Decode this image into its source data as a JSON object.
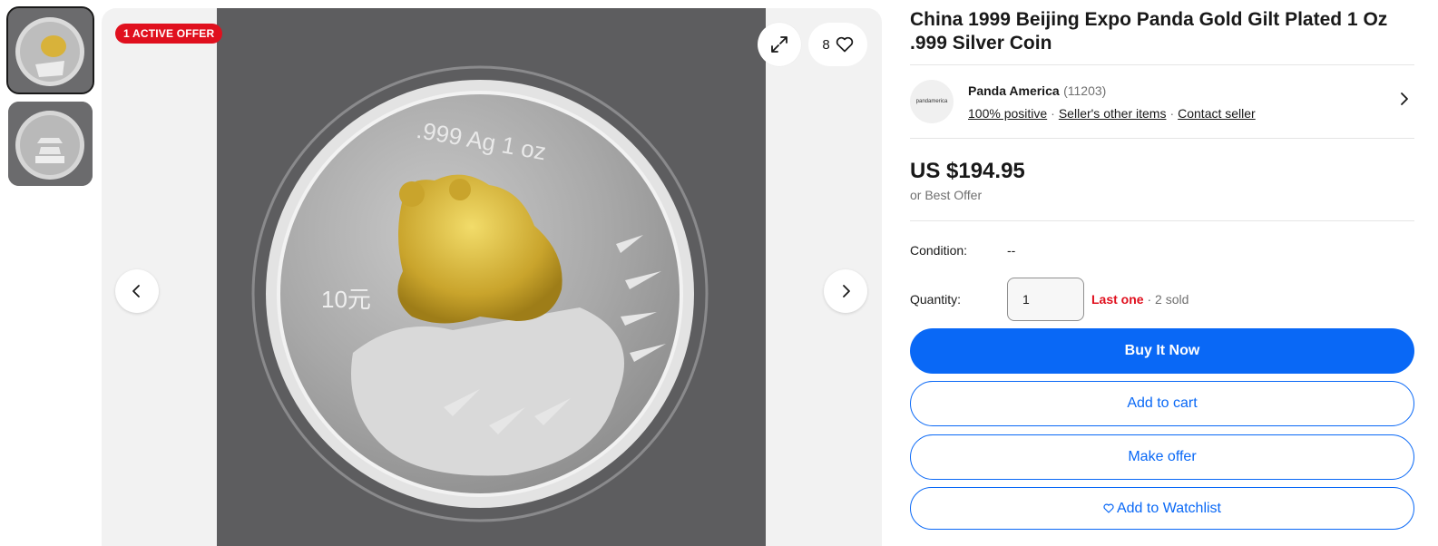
{
  "badge": {
    "active_offer": "1 ACTIVE OFFER"
  },
  "gallery": {
    "watch_count": "8",
    "icons": {
      "expand": "expand-icon",
      "heart": "heart-icon",
      "prev": "chevron-left-icon",
      "next": "chevron-right-icon"
    }
  },
  "coin": {
    "rim_text": ".999 Ag 1 oz",
    "denomination": "10元"
  },
  "listing": {
    "title": "China 1999 Beijing Expo Panda Gold Gilt Plated 1 Oz .999 Silver Coin"
  },
  "seller": {
    "logo_text": "pandamerica",
    "name": "Panda America",
    "feedback_count": "(11203)",
    "positive": "100% positive",
    "other_items": "Seller's other items",
    "contact": "Contact seller"
  },
  "price": {
    "amount": "US $194.95",
    "best_offer": "or Best Offer"
  },
  "condition": {
    "label": "Condition:",
    "value": "--"
  },
  "quantity": {
    "label": "Quantity:",
    "value": "1",
    "last_one": "Last one",
    "sold": "2 sold"
  },
  "actions": {
    "buy_now": "Buy It Now",
    "add_to_cart": "Add to cart",
    "make_offer": "Make offer",
    "watchlist": "Add to Watchlist"
  },
  "colors": {
    "primary": "#0968f6",
    "badge_red": "#e0101e",
    "text": "#191919",
    "muted": "#707070"
  }
}
